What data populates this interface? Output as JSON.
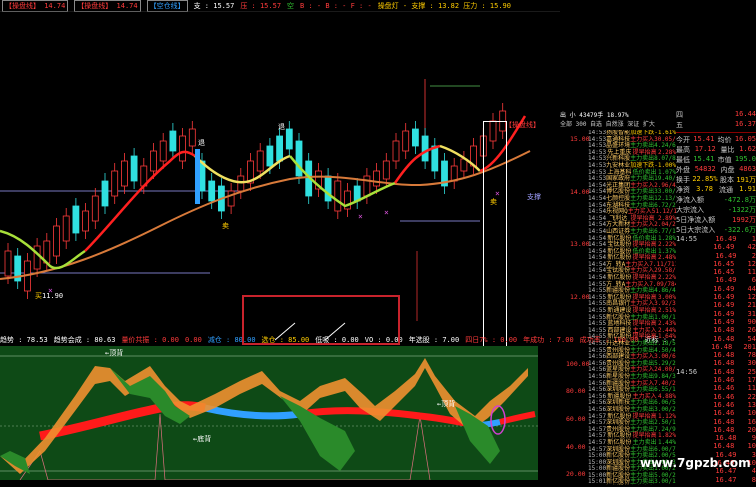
{
  "topbar": {
    "items": [
      {
        "label": "【操盘线】 14.74",
        "color": "#ff3b3b"
      },
      {
        "label": "【操盘线】 14.74",
        "color": "#ff3b3b"
      },
      {
        "label": "【空仓线】",
        "color": "#30a0ff"
      },
      {
        "label": "支 : 15.57",
        "color": "#ffffff"
      },
      {
        "label": "压 : 15.57",
        "color": "#ff3b3b"
      },
      {
        "label": "空",
        "color": "#30c030"
      },
      {
        "label": "B : - B : - F : -",
        "color": "#ff3b3b"
      },
      {
        "label": "操盘灯 - 支撑 : 13.82 压力 : 15.90",
        "color": "#ffcc00"
      }
    ]
  },
  "chart_labels": {
    "buy_label": "买",
    "low_price": "11.90",
    "sell_label_1": "卖",
    "sell_label_2": "卖",
    "support_label": "支撑",
    "pressure_tag": "【操盘线】",
    "arrow_label_1": "退",
    "arrow_label_2": "退"
  },
  "osc_bar": {
    "items": [
      {
        "label": "趋势 : 78.53",
        "color": "#ffffff"
      },
      {
        "label": "趋势会成 : 80.63",
        "color": "#ffffff"
      },
      {
        "label": "量价共振 : 0.00",
        "color": "#ff3b3b"
      },
      {
        "label": "0.00",
        "color": "#ff3b3b"
      },
      {
        "label": "减仓 : 80.00",
        "color": "#30a0ff"
      },
      {
        "label": "选仓 : 85.00",
        "color": "#ffcc00"
      },
      {
        "label": "低吸 : 0.00",
        "color": "#ffffff"
      },
      {
        "label": "VO : 0.00",
        "color": "#ffffff"
      },
      {
        "label": "年选股 : 7.00",
        "color": "#ffffff"
      },
      {
        "label": "四日7% : 0.00",
        "color": "#ff3b3b"
      },
      {
        "label": "年成功 : 7.00",
        "color": "#ff3b3b"
      },
      {
        "label": "成功率 : 100.00",
        "color": "#ff3b3b"
      },
      {
        "label": "近标 : -",
        "color": "#ffffff"
      }
    ]
  },
  "osc_labels": {
    "top_divergence_1": "←顶背",
    "top_divergence_2": "←顶背",
    "bottom_divergence": "←底背"
  },
  "price_axis": [
    "15.00",
    "14.00",
    "13.00",
    "12.00",
    "100.00",
    "80.00",
    "60.00",
    "40.00",
    "20.00"
  ],
  "tape_header": {
    "line1": "出 小 43479手 18.97%",
    "line2": "全部 300 自选 自然涨 深证 扩大"
  },
  "tape_rows": [
    {
      "time": "14:53",
      "name": "扬股智能",
      "type": "加速下跌",
      "val": "-1.61%",
      "c": "#ffcc00"
    },
    {
      "time": "14:53",
      "name": "嘉通科技",
      "type": "主力买入",
      "val": "30.05/1872",
      "c": "#ff3b3b"
    },
    {
      "time": "14:53",
      "name": "晶盛环境",
      "type": "主力卖出",
      "val": "4.24/65.1",
      "c": "#30c030"
    },
    {
      "time": "14:53",
      "name": "先上重庆",
      "type": "提早抬高",
      "val": "2.28%",
      "c": "#ff3b3b"
    },
    {
      "time": "14:53",
      "name": "兴新科股",
      "type": "主力卖出",
      "val": "8.07/86",
      "c": "#30c030"
    },
    {
      "time": "14:53",
      "name": "九安林业",
      "type": "加速下跌",
      "val": "-1.00%",
      "c": "#ffcc00"
    },
    {
      "time": "14:53",
      "name": "上海基科",
      "type": "低价卖出",
      "val": "1.07%",
      "c": "#30c030"
    },
    {
      "time": "14:53",
      "name": "国家政府",
      "type": "主力卖出",
      "val": "19.40/470",
      "c": "#30c030"
    },
    {
      "time": "14:54",
      "name": "光正集团",
      "type": "主力买入",
      "val": "2.96/4221",
      "c": "#ff3b3b"
    },
    {
      "time": "14:54",
      "name": "博亿股份",
      "type": "主力卖出",
      "val": "33.00/308",
      "c": "#30c030"
    },
    {
      "time": "14:54",
      "name": "七颜控股",
      "type": "主力卖出",
      "val": "12.13/692",
      "c": "#30c030"
    },
    {
      "time": "14:54",
      "name": "东湖科技",
      "type": "主力卖出",
      "val": "6.72/208",
      "c": "#30c030"
    },
    {
      "time": "14:54",
      "name": "乐视网Q",
      "type": "主力买入",
      "val": "51.12/1001",
      "c": "#ff3b3b"
    },
    {
      "time": "14:54",
      "name": "飞利达",
      "type": "提早抬高",
      "val": "2.89%",
      "c": "#ff3b3b"
    },
    {
      "time": "14:54",
      "name": "方大新材",
      "type": "主力买入",
      "val": "2.04/2871",
      "c": "#ff3b3b"
    },
    {
      "time": "14:54",
      "name": "山西证券",
      "type": "主力卖出",
      "val": "6.77/1083",
      "c": "#30c030"
    },
    {
      "time": "14:54",
      "name": "新亿股份",
      "type": "低价卖出",
      "val": "1.28%",
      "c": "#30c030"
    },
    {
      "time": "14:54",
      "name": "宝钛股份",
      "type": "提早抬高",
      "val": "2.22%",
      "c": "#ff3b3b"
    },
    {
      "time": "14:54",
      "name": "新亿股份",
      "type": "低价卖出",
      "val": "1.37%",
      "c": "#30c030"
    },
    {
      "time": "14:54",
      "name": "新亿股份",
      "type": "提早抬高",
      "val": "2.48%",
      "c": "#ff3b3b"
    },
    {
      "time": "14:54",
      "name": "方 转A",
      "type": "主力买入",
      "val": "7.11/7115",
      "c": "#ff3b3b"
    },
    {
      "time": "14:54",
      "name": "宝钛股份",
      "type": "主力买入",
      "val": "29.58/1050",
      "c": "#ff3b3b"
    },
    {
      "time": "14:54",
      "name": "新亿股份",
      "type": "提早抬高",
      "val": "2.22%",
      "c": "#ff3b3b"
    },
    {
      "time": "14:55",
      "name": "方 转A",
      "type": "主力买入",
      "val": "7.09/7848",
      "c": "#ff3b3b"
    },
    {
      "time": "14:55",
      "name": "新疆股份",
      "type": "主力卖出",
      "val": "4.86/4100",
      "c": "#30c030"
    },
    {
      "time": "14:55",
      "name": "新亿股份",
      "type": "提早抬高",
      "val": "3.00%",
      "c": "#ff3b3b"
    },
    {
      "time": "14:55",
      "name": "南昌银行",
      "type": "主力买入",
      "val": "3.92/3093",
      "c": "#ff3b3b"
    },
    {
      "time": "14:55",
      "name": "新通建设",
      "type": "提早抬高",
      "val": "2.51%",
      "c": "#ff3b3b"
    },
    {
      "time": "14:55",
      "name": "新亿股份",
      "type": "主力卖出",
      "val": "1.00/1025",
      "c": "#30c030"
    },
    {
      "time": "14:55",
      "name": "蓝地科技",
      "type": "提早抬高",
      "val": "2.43%",
      "c": "#ff3b3b"
    },
    {
      "time": "14:55",
      "name": "西部建设",
      "type": "主力买入",
      "val": "2.44%",
      "c": "#ff3b3b"
    },
    {
      "time": "14:55",
      "name": "新亿股份",
      "type": "提早抬高",
      "val": "1.64%",
      "c": "#ff3b3b"
    },
    {
      "time": "14:55",
      "name": "升达林业",
      "type": "主力卖出",
      "val": "2.18/5086",
      "c": "#30c030"
    },
    {
      "time": "14:55",
      "name": "贵州股份",
      "type": "主力卖出",
      "val": "4.50/4000",
      "c": "#30c030"
    },
    {
      "time": "14:56",
      "name": "西部建设",
      "type": "主力买入",
      "val": "3.00/600",
      "c": "#ff3b3b"
    },
    {
      "time": "14:56",
      "name": "贵州股份",
      "type": "主力卖出",
      "val": "5.29/2100",
      "c": "#30c030"
    },
    {
      "time": "14:56",
      "name": "蓝星股份",
      "type": "主力买入",
      "val": "24.00/1200",
      "c": "#ff3b3b"
    },
    {
      "time": "14:56",
      "name": "新星股份",
      "type": "主力卖出",
      "val": "9.84/3560",
      "c": "#30c030"
    },
    {
      "time": "14:56",
      "name": "新疆股份",
      "type": "主力买入",
      "val": "7.40/2220",
      "c": "#ff3b3b"
    },
    {
      "time": "14:56",
      "name": "深圳股份",
      "type": "主力卖出",
      "val": "6.55/1200",
      "c": "#30c030"
    },
    {
      "time": "14:56",
      "name": "新疆股份",
      "type": "主力买入",
      "val": "4.88%",
      "c": "#ff3b3b"
    },
    {
      "time": "14:56",
      "name": "深圳新技",
      "type": "主力卖出",
      "val": "6.06/5800",
      "c": "#30c030"
    },
    {
      "time": "14:56",
      "name": "深圳股份",
      "type": "主力卖出",
      "val": "3.00/2020",
      "c": "#30c030"
    },
    {
      "time": "14:57",
      "name": "新亿股份",
      "type": "提早抬高",
      "val": "1.12%",
      "c": "#ff3b3b"
    },
    {
      "time": "14:57",
      "name": "深圳股份",
      "type": "主力卖出",
      "val": "2.50/1800",
      "c": "#30c030"
    },
    {
      "time": "14:57",
      "name": "贵州股份",
      "type": "主力卖出",
      "val": "7.24/900",
      "c": "#30c030"
    },
    {
      "time": "14:57",
      "name": "新亿股份",
      "type": "提早抬高",
      "val": "1.82%",
      "c": "#ff3b3b"
    },
    {
      "time": "14:57",
      "name": "新亿股份",
      "type": "主力卖出",
      "val": "1.44%",
      "c": "#30c030"
    },
    {
      "time": "14:57",
      "name": "深圳股份",
      "type": "主力卖出",
      "val": "6.00/700",
      "c": "#30c030"
    },
    {
      "time": "15:00",
      "name": "新亿股份",
      "type": "主力卖出",
      "val": "2.00/500",
      "c": "#30c030"
    },
    {
      "time": "15:00",
      "name": "深圳股份",
      "type": "主力卖出",
      "val": "4.00/300",
      "c": "#30c030"
    },
    {
      "time": "15:00",
      "name": "新疆股份",
      "type": "主力卖出",
      "val": "1.00/200",
      "c": "#30c030"
    },
    {
      "time": "15:00",
      "name": "新亿股份",
      "type": "主力卖出",
      "val": "5.00/200",
      "c": "#30c030"
    },
    {
      "time": "15:01",
      "name": "新亿股份",
      "type": "主力卖出",
      "val": "3.00/100",
      "c": "#30c030"
    },
    {
      "time": "15:01",
      "name": "深圳股份",
      "type": "主力卖出",
      "val": "2.00/100",
      "c": "#30c030"
    },
    {
      "time": "15:01",
      "name": "新疆股份",
      "type": "主力卖出",
      "val": "1.00/100",
      "c": "#30c030"
    },
    {
      "time": "15:01",
      "name": "新亿股份",
      "type": "主力卖出",
      "val": "1.00/100",
      "c": "#30c030"
    }
  ],
  "quote": {
    "top_rows": [
      {
        "label": "四",
        "value": "16.44",
        "c": "#ff3b3b"
      },
      {
        "label": "五",
        "value": "16.37",
        "c": "#ff3b3b"
      }
    ],
    "stats": [
      {
        "a": "今开",
        "av": "15.41",
        "b": "均价",
        "bv": "16.05",
        "c": "#ff3b3b"
      },
      {
        "a": "最高",
        "av": "17.12",
        "b": "量比",
        "bv": "1.62",
        "c": "#ff3b3b"
      },
      {
        "a": "最低",
        "av": "15.41",
        "b": "市值",
        "bv": "195.0",
        "c": "#30c030"
      },
      {
        "a": "外盘",
        "av": "54832",
        "b": "内盘",
        "bv": "4863",
        "c": "#ff3b3b"
      },
      {
        "a": "换手",
        "av": "22.85%",
        "b": "股本",
        "bv": "191万",
        "c": "#ffcc00"
      },
      {
        "a": "净资",
        "av": "3.78",
        "b": "流通",
        "bv": "1.91",
        "c": "#ffcc00"
      },
      {
        "a": "净流入额",
        "av": "-472.8万",
        "b": "",
        "bv": "",
        "c": "#30c030"
      },
      {
        "a": "大宗流入",
        "av": "-1322万",
        "b": "",
        "bv": "",
        "c": "#30c030"
      },
      {
        "a": "5日净流入额",
        "av": "1992万",
        "b": "",
        "bv": "",
        "c": "#ff3b3b"
      },
      {
        "a": "5日大宗流入",
        "av": "-322.6万",
        "b": "",
        "bv": "",
        "c": "#30c030"
      }
    ],
    "ticks": [
      {
        "t": "14:55",
        "p": "16.49",
        "v": "1",
        "c": "#ff3b3b"
      },
      {
        "t": "",
        "p": "16.49",
        "v": "42",
        "c": "#ff3b3b"
      },
      {
        "t": "",
        "p": "16.49",
        "v": "2",
        "c": "#ff3b3b"
      },
      {
        "t": "",
        "p": "16.45",
        "v": "12",
        "c": "#ff3b3b"
      },
      {
        "t": "",
        "p": "16.45",
        "v": "11",
        "c": "#ff3b3b"
      },
      {
        "t": "",
        "p": "16.49",
        "v": "6",
        "c": "#ff3b3b"
      },
      {
        "t": "",
        "p": "16.49",
        "v": "44",
        "c": "#ff3b3b"
      },
      {
        "t": "",
        "p": "16.49",
        "v": "12",
        "c": "#ff3b3b"
      },
      {
        "t": "",
        "p": "16.49",
        "v": "21",
        "c": "#ff3b3b"
      },
      {
        "t": "",
        "p": "16.49",
        "v": "31",
        "c": "#ff3b3b"
      },
      {
        "t": "",
        "p": "16.49",
        "v": "90",
        "c": "#ff3b3b"
      },
      {
        "t": "",
        "p": "16.48",
        "v": "26",
        "c": "#ff3b3b"
      },
      {
        "t": "",
        "p": "16.48",
        "v": "54",
        "c": "#ff3b3b"
      },
      {
        "t": "",
        "p": "16.48",
        "v": "201",
        "c": "#ff3b3b"
      },
      {
        "t": "",
        "p": "16.48",
        "v": "78",
        "c": "#ff3b3b"
      },
      {
        "t": "",
        "p": "16.48",
        "v": "30",
        "c": "#ff3b3b"
      },
      {
        "t": "14:56",
        "p": "16.48",
        "v": "25",
        "c": "#ff3b3b"
      },
      {
        "t": "",
        "p": "16.46",
        "v": "17",
        "c": "#ff3b3b"
      },
      {
        "t": "",
        "p": "16.46",
        "v": "11",
        "c": "#ff3b3b"
      },
      {
        "t": "",
        "p": "16.46",
        "v": "22",
        "c": "#ff3b3b"
      },
      {
        "t": "",
        "p": "16.46",
        "v": "13",
        "c": "#ff3b3b"
      },
      {
        "t": "",
        "p": "16.46",
        "v": "10",
        "c": "#ff3b3b"
      },
      {
        "t": "",
        "p": "16.48",
        "v": "16",
        "c": "#ff3b3b"
      },
      {
        "t": "",
        "p": "16.48",
        "v": "20",
        "c": "#ff3b3b"
      },
      {
        "t": "",
        "p": "16.48",
        "v": "9",
        "c": "#ff3b3b"
      },
      {
        "t": "",
        "p": "16.48",
        "v": "10",
        "c": "#ff3b3b"
      },
      {
        "t": "",
        "p": "16.49",
        "v": "3",
        "c": "#ff3b3b"
      },
      {
        "t": "",
        "p": "16.49",
        "v": "10",
        "c": "#ff3b3b"
      },
      {
        "t": "",
        "p": "16.47",
        "v": "4",
        "c": "#ff3b3b"
      },
      {
        "t": "",
        "p": "16.47",
        "v": "8",
        "c": "#ff3b3b"
      }
    ]
  },
  "watermark": "www.7gpzb.com",
  "colors": {
    "up": "#ff3b3b",
    "down": "#30c030",
    "accent": "#ffcc00",
    "blue": "#30a0ff"
  }
}
